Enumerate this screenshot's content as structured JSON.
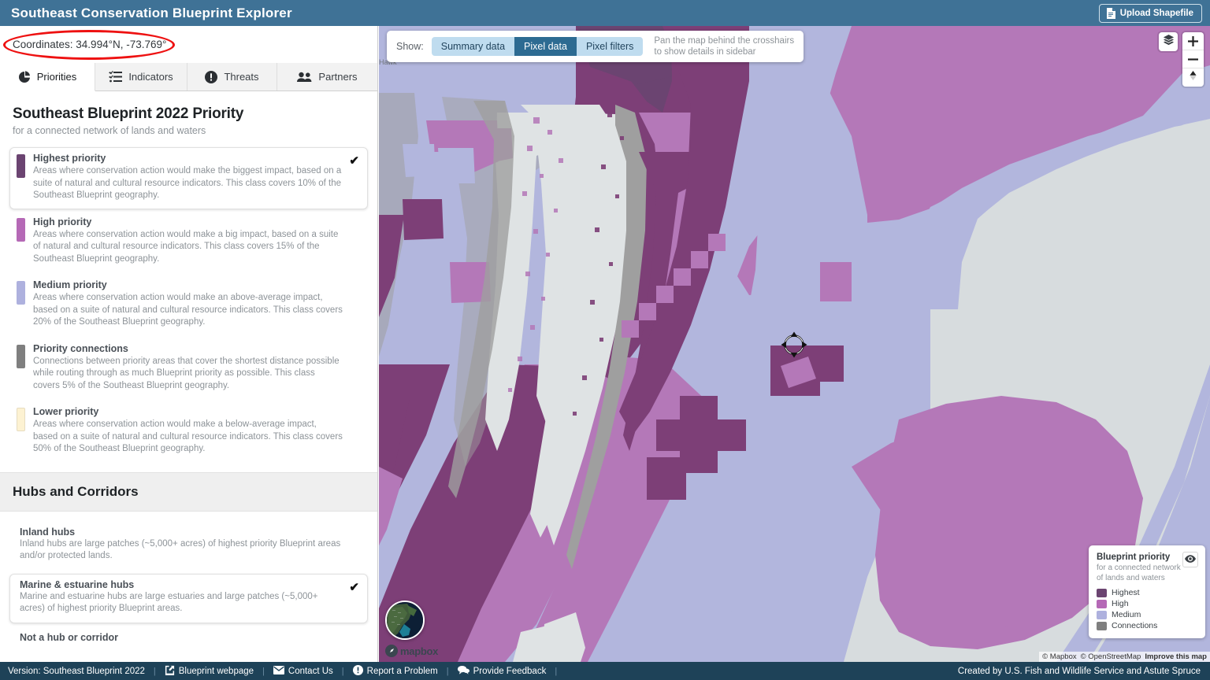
{
  "header": {
    "title": "Southeast  Conservation Blueprint Explorer",
    "upload_label": "Upload Shapefile",
    "upload_icon": "file-icon",
    "bg_color": "#3f7296"
  },
  "sidebar": {
    "coordinates_label": "Coordinates: 34.994°N, -73.769°",
    "tabs": [
      {
        "label": "Priorities",
        "icon": "pie-chart-icon",
        "active": true
      },
      {
        "label": "Indicators",
        "icon": "checklist-icon",
        "active": false
      },
      {
        "label": "Threats",
        "icon": "exclamation-circle-icon",
        "active": false
      },
      {
        "label": "Partners",
        "icon": "people-icon",
        "active": false
      }
    ],
    "panel": {
      "title": "Southeast Blueprint 2022 Priority",
      "subtitle": "for a connected network of lands and waters"
    },
    "priorities": [
      {
        "label": "Highest priority",
        "color": "#6b4471",
        "selected": true,
        "description": "Areas where conservation action would make the biggest impact, based on a suite of natural and cultural resource indicators. This class covers 10% of the Southeast Blueprint geography."
      },
      {
        "label": "High priority",
        "color": "#b569b6",
        "selected": false,
        "description": "Areas where conservation action would make a big impact, based on a suite of natural and cultural resource indicators. This class covers 15% of the Southeast Blueprint geography."
      },
      {
        "label": "Medium priority",
        "color": "#aeb1de",
        "selected": false,
        "description": "Areas where conservation action would make an above-average impact, based on a suite of natural and cultural resource indicators. This class covers 20% of the Southeast Blueprint geography."
      },
      {
        "label": "Priority connections",
        "color": "#7f7f7f",
        "selected": false,
        "description": "Connections between priority areas that cover the shortest distance possible while routing through as much Blueprint priority as possible. This class covers 5% of the Southeast Blueprint geography."
      },
      {
        "label": "Lower priority",
        "color": "#fdf2d2",
        "selected": false,
        "description": "Areas where conservation action would make a below-average impact, based on a suite of natural and cultural resource indicators. This class covers 50% of the Southeast Blueprint geography."
      }
    ],
    "hubs_section": {
      "title": "Hubs and Corridors",
      "items": [
        {
          "label": "Inland hubs",
          "selected": false,
          "description": "Inland hubs are large patches (~5,000+ acres) of highest priority Blueprint areas and/or protected lands."
        },
        {
          "label": "Marine & estuarine hubs",
          "selected": true,
          "description": "Marine and estuarine hubs are large estuaries and large patches (~5,000+ acres) of highest priority Blueprint areas."
        },
        {
          "label": "Not a hub or corridor",
          "selected": false,
          "description": ""
        }
      ]
    }
  },
  "map": {
    "show_label": "Show:",
    "show_buttons": [
      {
        "label": "Summary data",
        "active": false
      },
      {
        "label": "Pixel data",
        "active": true
      },
      {
        "label": "Pixel filters",
        "active": false
      }
    ],
    "hint_line1": "Pan the map behind the crosshairs",
    "hint_line2": "to show details in sidebar",
    "controls": {
      "layers_icon": "layers-icon",
      "zoom_in_label": "+",
      "zoom_out_label": "−",
      "compass_icon": "compass-icon"
    },
    "basemap_toggle_icon": "satellite-thumbnail-icon",
    "crosshair_icon": "crosshair-icon",
    "mapbox_label": "mapbox",
    "legend": {
      "title": "Blueprint priority",
      "subtitle_line1": "for a connected network",
      "subtitle_line2": "of lands and waters",
      "eye_icon": "eye-icon",
      "rows": [
        {
          "label": "Highest",
          "color": "#6b4471"
        },
        {
          "label": "High",
          "color": "#b569b6"
        },
        {
          "label": "Medium",
          "color": "#aeb1de"
        },
        {
          "label": "Connections",
          "color": "#7f7f7f"
        }
      ]
    },
    "attribution": {
      "mapbox": "© Mapbox",
      "osm": "© OpenStreetMap",
      "improve": "Improve this map"
    },
    "colors": {
      "highest": "#7d3f77",
      "high": "#b478b8",
      "medium": "#b2b6dd",
      "lower": "#d7dcde",
      "connections": "#9c9c9c",
      "land": "#d7dcde"
    },
    "label_kitty_hawk": "Hawk"
  },
  "footer": {
    "version": "Version: Southeast Blueprint 2022",
    "links": [
      {
        "label": "Blueprint webpage",
        "icon": "external-link-icon"
      },
      {
        "label": "Contact Us",
        "icon": "envelope-icon"
      },
      {
        "label": "Report a Problem",
        "icon": "exclamation-circle-icon"
      },
      {
        "label": "Provide Feedback",
        "icon": "chat-icon"
      }
    ],
    "credit": "Created by U.S. Fish and Wildlife Service and Astute Spruce",
    "separator": "|",
    "bg_color": "#1e4258"
  }
}
